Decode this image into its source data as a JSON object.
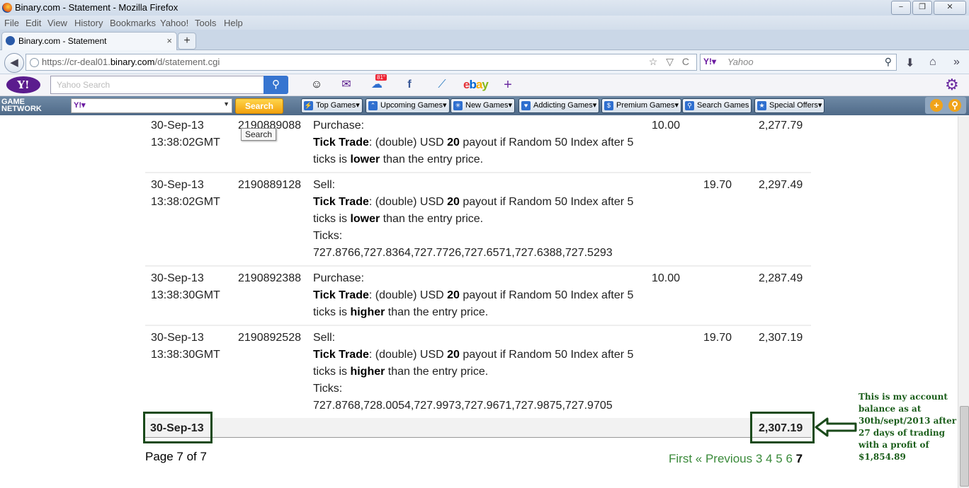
{
  "window": {
    "title": "Binary.com - Statement - Mozilla Firefox",
    "min": "−",
    "max": "❐",
    "close": "✕"
  },
  "menu": [
    "File",
    "Edit",
    "View",
    "History",
    "Bookmarks",
    "Yahoo!",
    "Tools",
    "Help"
  ],
  "tab": {
    "label": "Binary.com - Statement",
    "close": "×",
    "new": "+"
  },
  "nav": {
    "url_prefix": "https://cr-deal01.",
    "url_host": "binary.com",
    "url_path": "/d/statement.cgi",
    "url_icons": "☆ ▽ C",
    "search_engine": "Y!▾",
    "search_placeholder": "Yahoo"
  },
  "yahoo": {
    "logo": "Y!",
    "search_placeholder": "Yahoo Search",
    "weather_badge": "81°",
    "ebay": "ebay"
  },
  "gamebar": {
    "logo_line1": "GAME",
    "logo_line2": "NETWORK",
    "engine": "Y!▾",
    "search_label": "Search",
    "buttons": [
      "Top Games▾",
      "Upcoming Games▾",
      "New Games▾",
      "Addicting Games▾",
      "Premium Games▾",
      "Search Games",
      "Special Offers▾"
    ]
  },
  "tooltip": "Search",
  "rows": [
    {
      "date": "30-Sep-13",
      "time": "13:38:02GMT",
      "ref": "2190889088",
      "action": "Purchase:",
      "trade_label": "Tick Trade",
      "desc_a": ": (double) USD ",
      "amount": "20",
      "desc_b": " payout if Random 50 Index after 5",
      "desc_c": "ticks is ",
      "direction": "lower",
      "desc_d": " than the entry price.",
      "ticks_label": "",
      "ticks": "",
      "debit": "10.00",
      "credit": "",
      "balance": "2,277.79"
    },
    {
      "date": "30-Sep-13",
      "time": "13:38:02GMT",
      "ref": "2190889128",
      "action": "Sell:",
      "trade_label": "Tick Trade",
      "desc_a": ": (double) USD ",
      "amount": "20",
      "desc_b": " payout if Random 50 Index after 5",
      "desc_c": "ticks is ",
      "direction": "lower",
      "desc_d": " than the entry price.",
      "ticks_label": "Ticks:",
      "ticks": "727.8766,727.8364,727.7726,727.6571,727.6388,727.5293",
      "debit": "",
      "credit": "19.70",
      "balance": "2,297.49"
    },
    {
      "date": "30-Sep-13",
      "time": "13:38:30GMT",
      "ref": "2190892388",
      "action": "Purchase:",
      "trade_label": "Tick Trade",
      "desc_a": ": (double) USD ",
      "amount": "20",
      "desc_b": " payout if Random 50 Index after 5",
      "desc_c": "ticks is ",
      "direction": "higher",
      "desc_d": " than the entry price.",
      "ticks_label": "",
      "ticks": "",
      "debit": "10.00",
      "credit": "",
      "balance": "2,287.49"
    },
    {
      "date": "30-Sep-13",
      "time": "13:38:30GMT",
      "ref": "2190892528",
      "action": "Sell:",
      "trade_label": "Tick Trade",
      "desc_a": ": (double) USD ",
      "amount": "20",
      "desc_b": " payout if Random 50 Index after 5",
      "desc_c": "ticks is ",
      "direction": "higher",
      "desc_d": " than the entry price.",
      "ticks_label": "Ticks:",
      "ticks": "727.8768,728.0054,727.9973,727.9671,727.9875,727.9705",
      "debit": "",
      "credit": "19.70",
      "balance": "2,307.19"
    }
  ],
  "total": {
    "date": "30-Sep-13",
    "balance": "2,307.19"
  },
  "pagination": {
    "info": "Page 7 of 7",
    "first": "First",
    "prev": "« Previous",
    "pages": [
      "3",
      "4",
      "5",
      "6"
    ],
    "current": "7"
  },
  "annotation": {
    "arrow": "⇦",
    "text": "This is my account balance as at 30th/sept/2013 after 27 days of trading with a profit of $1,854.89"
  },
  "colors": {
    "annotation_green": "#1a4a1a",
    "link_green": "#3a8a3a",
    "yahoo_purple": "#5b1c8e"
  }
}
